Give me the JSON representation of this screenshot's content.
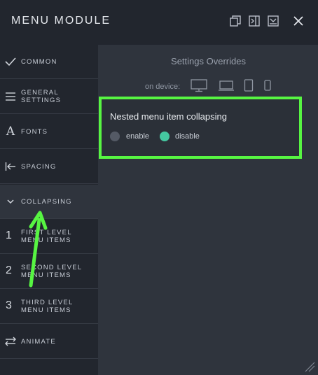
{
  "header": {
    "title": "MENU MODULE",
    "icons": [
      "duplicate-icon",
      "sidebar-toggle-icon",
      "minimize-icon",
      "close-icon"
    ]
  },
  "sidebar": {
    "items": [
      {
        "label": "COMMON",
        "icon": "checkmark-icon",
        "active": false
      },
      {
        "label": "GENERAL SETTINGS",
        "icon": "hamburger-icon",
        "active": false
      },
      {
        "label": "FONTS",
        "icon": "font-icon",
        "glyph": "A",
        "active": false
      },
      {
        "label": "SPACING",
        "icon": "spacing-icon",
        "active": false
      },
      {
        "label": "COLLAPSING",
        "icon": "chevron-down-icon",
        "active": true
      },
      {
        "label": "FIRST LEVEL MENU ITEMS",
        "number": "1",
        "active": false
      },
      {
        "label": "SECOND LEVEL MENU ITEMS",
        "number": "2",
        "active": false
      },
      {
        "label": "THIRD LEVEL MENU ITEMS",
        "number": "3",
        "active": false
      },
      {
        "label": "ANIMATE",
        "icon": "swap-arrows-icon",
        "active": false
      }
    ]
  },
  "main": {
    "overrides_title": "Settings Overrides",
    "device_label": "on device:",
    "devices": [
      "desktop-icon",
      "laptop-icon",
      "tablet-icon",
      "phone-icon"
    ],
    "setting": {
      "title": "Nested menu item collapsing",
      "options": [
        {
          "label": "enable",
          "selected": false
        },
        {
          "label": "disable",
          "selected": true
        }
      ]
    }
  },
  "colors": {
    "panel_bg": "#2f343d",
    "sidebar_bg": "#22262e",
    "highlight_border": "#57f542",
    "radio_selected": "#45c7a0",
    "radio_unselected": "#545a65"
  }
}
